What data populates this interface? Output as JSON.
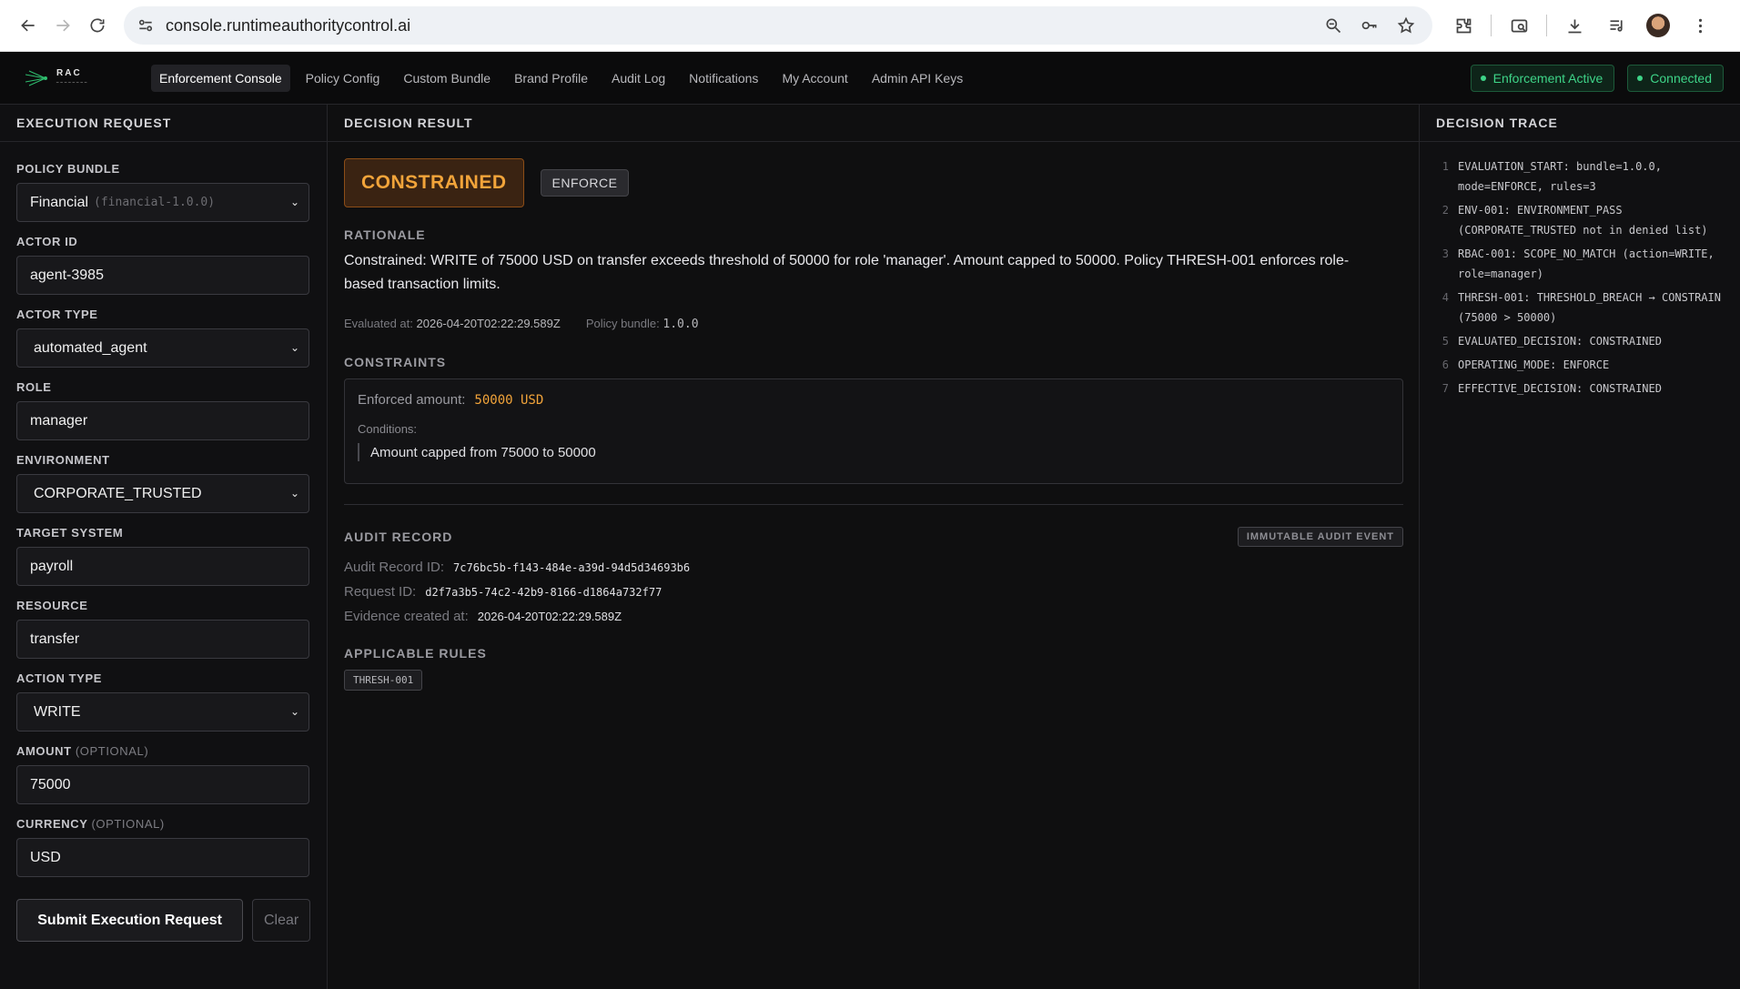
{
  "browser": {
    "url": "console.runtimeauthoritycontrol.ai"
  },
  "app": {
    "logo_text": "RAC",
    "nav": [
      {
        "label": "Enforcement Console",
        "active": true
      },
      {
        "label": "Policy Config"
      },
      {
        "label": "Custom Bundle"
      },
      {
        "label": "Brand Profile"
      },
      {
        "label": "Audit Log"
      },
      {
        "label": "Notifications"
      },
      {
        "label": "My Account"
      },
      {
        "label": "Admin API Keys"
      }
    ],
    "status": [
      "Enforcement Active",
      "Connected"
    ],
    "status_color": "#3ed488"
  },
  "request": {
    "title": "EXECUTION REQUEST",
    "policy_bundle_label": "POLICY BUNDLE",
    "policy_bundle_value": "Financial",
    "policy_bundle_id": "(financial-1.0.0)",
    "actor_id_label": "ACTOR ID",
    "actor_id": "agent-3985",
    "actor_type_label": "ACTOR TYPE",
    "actor_type": "automated_agent",
    "role_label": "ROLE",
    "role": "manager",
    "environment_label": "ENVIRONMENT",
    "environment": "CORPORATE_TRUSTED",
    "target_label": "TARGET SYSTEM",
    "target": "payroll",
    "resource_label": "RESOURCE",
    "resource": "transfer",
    "action_label": "ACTION TYPE",
    "action": "WRITE",
    "amount_label": "AMOUNT",
    "amount_opt": "(OPTIONAL)",
    "amount": "75000",
    "currency_label": "CURRENCY",
    "currency_opt": "(OPTIONAL)",
    "currency": "USD",
    "submit": "Submit Execution Request",
    "clear": "Clear"
  },
  "result": {
    "title": "DECISION RESULT",
    "decision": "CONSTRAINED",
    "mode": "ENFORCE",
    "decision_color": "#f2a43a",
    "rationale_label": "RATIONALE",
    "rationale": "Constrained: WRITE of 75000 USD on transfer exceeds threshold of 50000 for role 'manager'. Amount capped to 50000. Policy THRESH-001 enforces role-based transaction limits.",
    "evaluated_label": "Evaluated at:",
    "evaluated_at": "2026-04-20T02:22:29.589Z",
    "bundle_label": "Policy bundle:",
    "bundle": "1.0.0",
    "constraints_label": "CONSTRAINTS",
    "enforced_label": "Enforced amount:",
    "enforced_amount": "50000 USD",
    "conditions_label": "Conditions:",
    "condition": "Amount capped from 75000 to 50000",
    "audit_label": "AUDIT RECORD",
    "immutable": "IMMUTABLE AUDIT EVENT",
    "audit_id_label": "Audit Record ID:",
    "audit_id": "7c76bc5b-f143-484e-a39d-94d5d34693b6",
    "request_id_label": "Request ID:",
    "request_id": "d2f7a3b5-74c2-42b9-8166-d1864a732f77",
    "evidence_label": "Evidence created at:",
    "evidence_at": "2026-04-20T02:22:29.589Z",
    "rules_label": "APPLICABLE RULES",
    "rule": "THRESH-001"
  },
  "trace": {
    "title": "DECISION TRACE",
    "items": [
      {
        "n": "1",
        "text": "EVALUATION_START: bundle=1.0.0, mode=ENFORCE, rules=3"
      },
      {
        "n": "2",
        "text": "ENV-001: ENVIRONMENT_PASS (CORPORATE_TRUSTED not in denied list)"
      },
      {
        "n": "3",
        "text": "RBAC-001: SCOPE_NO_MATCH (action=WRITE, role=manager)"
      },
      {
        "n": "4",
        "text": "THRESH-001: THRESHOLD_BREACH → CONSTRAIN (75000 > 50000)"
      },
      {
        "n": "5",
        "text": "EVALUATED_DECISION: CONSTRAINED"
      },
      {
        "n": "6",
        "text": "OPERATING_MODE: ENFORCE"
      },
      {
        "n": "7",
        "text": "EFFECTIVE_DECISION: CONSTRAINED"
      }
    ]
  }
}
